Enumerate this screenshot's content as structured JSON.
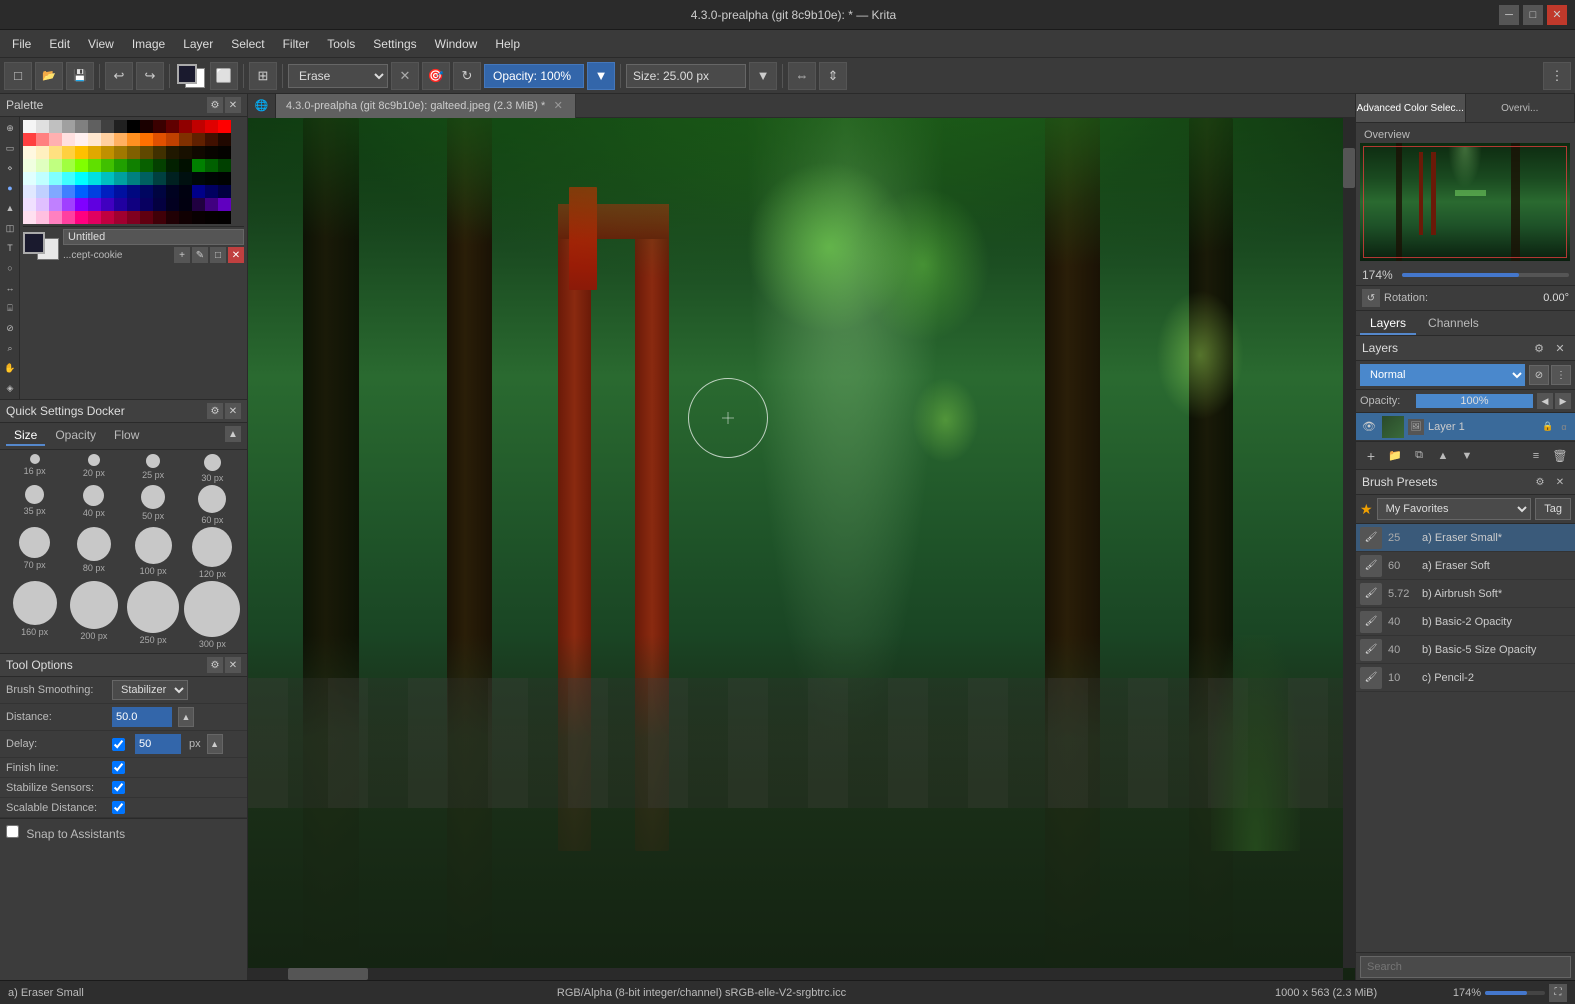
{
  "titlebar": {
    "title": "4.3.0-prealpha (git 8c9b10e): * — Krita"
  },
  "menubar": {
    "items": [
      "File",
      "Edit",
      "View",
      "Image",
      "Layer",
      "Select",
      "Filter",
      "Tools",
      "Settings",
      "Window",
      "Help"
    ]
  },
  "toolbar": {
    "erase_label": "Erase",
    "opacity_label": "Opacity: 100%",
    "size_label": "Size: 25.00 px"
  },
  "canvas_tab": {
    "label": "4.3.0-prealpha (git 8c9b10e): galteed.jpeg (2.3 MiB) *"
  },
  "left_panel": {
    "palette_title": "Palette",
    "untitled_label": "Untitled",
    "cookie_label": "...cept-cookie",
    "quick_settings_title": "Quick Settings Docker",
    "size_tab": "Size",
    "opacity_tab": "Opacity",
    "flow_tab": "Flow",
    "brush_sizes": [
      {
        "px": "16 px",
        "size": 10
      },
      {
        "px": "20 px",
        "size": 12
      },
      {
        "px": "25 px",
        "size": 14
      },
      {
        "px": "30 px",
        "size": 17
      },
      {
        "px": "35 px",
        "size": 19
      },
      {
        "px": "40 px",
        "size": 21
      },
      {
        "px": "50 px",
        "size": 24
      },
      {
        "px": "60 px",
        "size": 28
      },
      {
        "px": "70 px",
        "size": 31
      },
      {
        "px": "80 px",
        "size": 34
      },
      {
        "px": "100 px",
        "size": 37
      },
      {
        "px": "120 px",
        "size": 40
      },
      {
        "px": "160 px",
        "size": 44
      },
      {
        "px": "200 px",
        "size": 48
      },
      {
        "px": "250 px",
        "size": 52
      },
      {
        "px": "300 px",
        "size": 56
      }
    ],
    "tool_options_title": "Tool Options",
    "brush_smoothing_label": "Brush Smoothing:",
    "brush_smoothing_value": "Stabilizer",
    "distance_label": "Distance:",
    "distance_value": "50.0",
    "delay_label": "Delay:",
    "delay_value": "50",
    "delay_unit": "px",
    "finish_line_label": "Finish line:",
    "stabilize_sensors_label": "Stabilize Sensors:",
    "scalable_distance_label": "Scalable Distance:",
    "snap_to_label": "Snap to Assistants"
  },
  "right_panel": {
    "adv_color_tab": "Advanced Color Selec...",
    "overview_tab": "Overvi...",
    "overview_label": "Overview",
    "zoom_pct": "174%",
    "rotation_label": "Rotation:",
    "rotation_value": "0.00°",
    "layers_tab": "Layers",
    "channels_tab": "Channels",
    "layers_title": "Layers",
    "blend_mode": "Normal",
    "opacity_label": "Opacity:",
    "opacity_value": "100%",
    "layer1_name": "Layer 1",
    "brush_presets_title": "Brush Presets",
    "favorites_label": "My Favorites",
    "tag_label": "Tag",
    "presets": [
      {
        "num": "25",
        "name": "a) Eraser Small*",
        "active": true
      },
      {
        "num": "60",
        "name": "a) Eraser Soft",
        "active": false
      },
      {
        "num": "5.72",
        "name": "b) Airbrush Soft*",
        "active": false
      },
      {
        "num": "40",
        "name": "b) Basic-2 Opacity",
        "active": false
      },
      {
        "num": "40",
        "name": "b) Basic-5 Size Opacity",
        "active": false
      },
      {
        "num": "10",
        "name": "c) Pencil-2",
        "active": false
      }
    ],
    "search_placeholder": "Search"
  },
  "statusbar": {
    "brush_label": "a) Eraser Small",
    "color_info": "RGB/Alpha (8-bit integer/channel)  sRGB-elle-V2-srgbtrc.icc",
    "dimensions": "1000 x 563 (2.3 MiB)",
    "zoom_value": "174%"
  },
  "palette_colors": [
    [
      "#f5f5f5",
      "#e0e0e0",
      "#c0c0c0",
      "#a0a0a0",
      "#808080",
      "#606060",
      "#404040",
      "#202020",
      "#000000",
      "#1a0000",
      "#3a0000",
      "#600000",
      "#900000",
      "#c00000",
      "#e00000",
      "#ff0000"
    ],
    [
      "#ff4040",
      "#ff8080",
      "#ffb0b0",
      "#ffe0e0",
      "#fff0f0",
      "#ffe8d0",
      "#ffd0a0",
      "#ffb060",
      "#ff9020",
      "#ff7000",
      "#e05000",
      "#c04000",
      "#803000",
      "#602000",
      "#401000",
      "#200800"
    ],
    [
      "#fff8e0",
      "#fff0c0",
      "#ffe080",
      "#ffd040",
      "#ffc000",
      "#e0a800",
      "#c09000",
      "#a07800",
      "#806000",
      "#604800",
      "#403000",
      "#201800",
      "#181000",
      "#100800",
      "#080400",
      "#040200"
    ],
    [
      "#f0ffe0",
      "#e0ffc0",
      "#c0ff80",
      "#a0ff40",
      "#80ff00",
      "#60e000",
      "#40c000",
      "#20a000",
      "#108000",
      "#086000",
      "#044000",
      "#022000",
      "#011000",
      "#008000",
      "#006000",
      "#004000"
    ],
    [
      "#e0ffff",
      "#c0ffff",
      "#80ffff",
      "#40ffff",
      "#00ffff",
      "#00e0e0",
      "#00c0c0",
      "#00a0a0",
      "#008080",
      "#006060",
      "#004040",
      "#002020",
      "#001010",
      "#000808",
      "#000404",
      "#000202"
    ],
    [
      "#e0e8ff",
      "#c0d0ff",
      "#80a8ff",
      "#4080ff",
      "#0060ff",
      "#0040e0",
      "#0020c0",
      "#0010a0",
      "#000880",
      "#000660",
      "#000440",
      "#000220",
      "#000110",
      "#000088",
      "#000060",
      "#000040"
    ],
    [
      "#f0e0ff",
      "#e0c0ff",
      "#c080ff",
      "#a040ff",
      "#8000ff",
      "#6000e0",
      "#4000c0",
      "#2000a0",
      "#100080",
      "#080060",
      "#040040",
      "#020020",
      "#010010",
      "#200040",
      "#400080",
      "#6000c0"
    ],
    [
      "#ffe0f0",
      "#ffc0e0",
      "#ff80c0",
      "#ff40a0",
      "#ff0080",
      "#e00060",
      "#c00040",
      "#a00030",
      "#800020",
      "#600010",
      "#400008",
      "#200004",
      "#100002",
      "#080001",
      "#040000",
      "#020000"
    ]
  ],
  "icons": {
    "new": "□",
    "open": "📂",
    "save": "💾",
    "undo": "↩",
    "redo": "↪",
    "fg_bg": "◨",
    "reset": "⊠",
    "brush_preset": "🖌",
    "grid": "⊞",
    "mirror_h": "⇔",
    "mirror_v": "⇕",
    "more": "⋮",
    "add_layer": "+",
    "delete_layer": "🗑",
    "move_up": "▲",
    "move_down": "▼",
    "flatten": "≡",
    "expand": "▸",
    "collapse": "▾",
    "search": "🔍",
    "pin": "📌",
    "eye": "👁",
    "lock": "🔒",
    "alpha_lock": "α"
  }
}
